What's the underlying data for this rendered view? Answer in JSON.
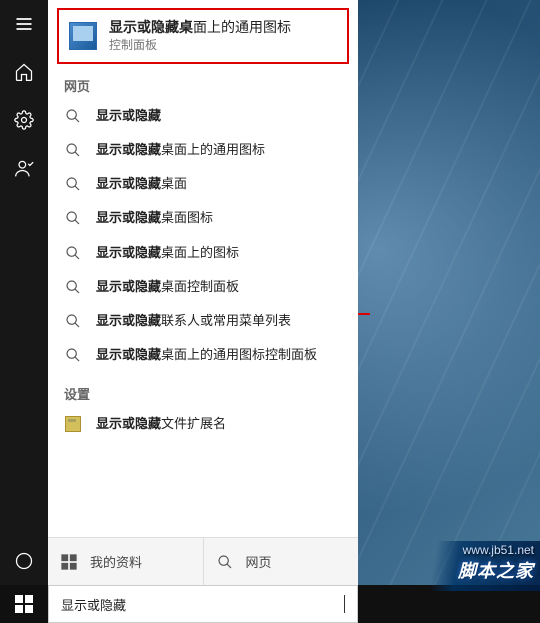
{
  "best_match": {
    "bold": "显示或隐藏桌",
    "rest": "面上的通用图标",
    "subtitle": "控制面板"
  },
  "sections": {
    "web": "网页",
    "settings": "设置"
  },
  "web_results": [
    {
      "bold": "显示或隐藏",
      "rest": ""
    },
    {
      "bold": "显示或隐藏",
      "rest": "桌面上的通用图标"
    },
    {
      "bold": "显示或隐藏",
      "rest": "桌面"
    },
    {
      "bold": "显示或隐藏",
      "rest": "桌面图标"
    },
    {
      "bold": "显示或隐藏",
      "rest": "桌面上的图标"
    },
    {
      "bold": "显示或隐藏",
      "rest": "桌面控制面板"
    },
    {
      "bold": "显示或隐藏",
      "rest": "联系人或常用菜单列表"
    },
    {
      "bold": "显示或隐藏",
      "rest": "桌面上的通用图标控制面板"
    }
  ],
  "settings_results": [
    {
      "bold": "显示或隐藏",
      "rest": "文件扩展名"
    }
  ],
  "tabs": {
    "my": "我的资料",
    "web": "网页"
  },
  "search_value": "显示或隐藏",
  "watermark": {
    "url": "www.jb51.net",
    "name": "脚本之家"
  }
}
